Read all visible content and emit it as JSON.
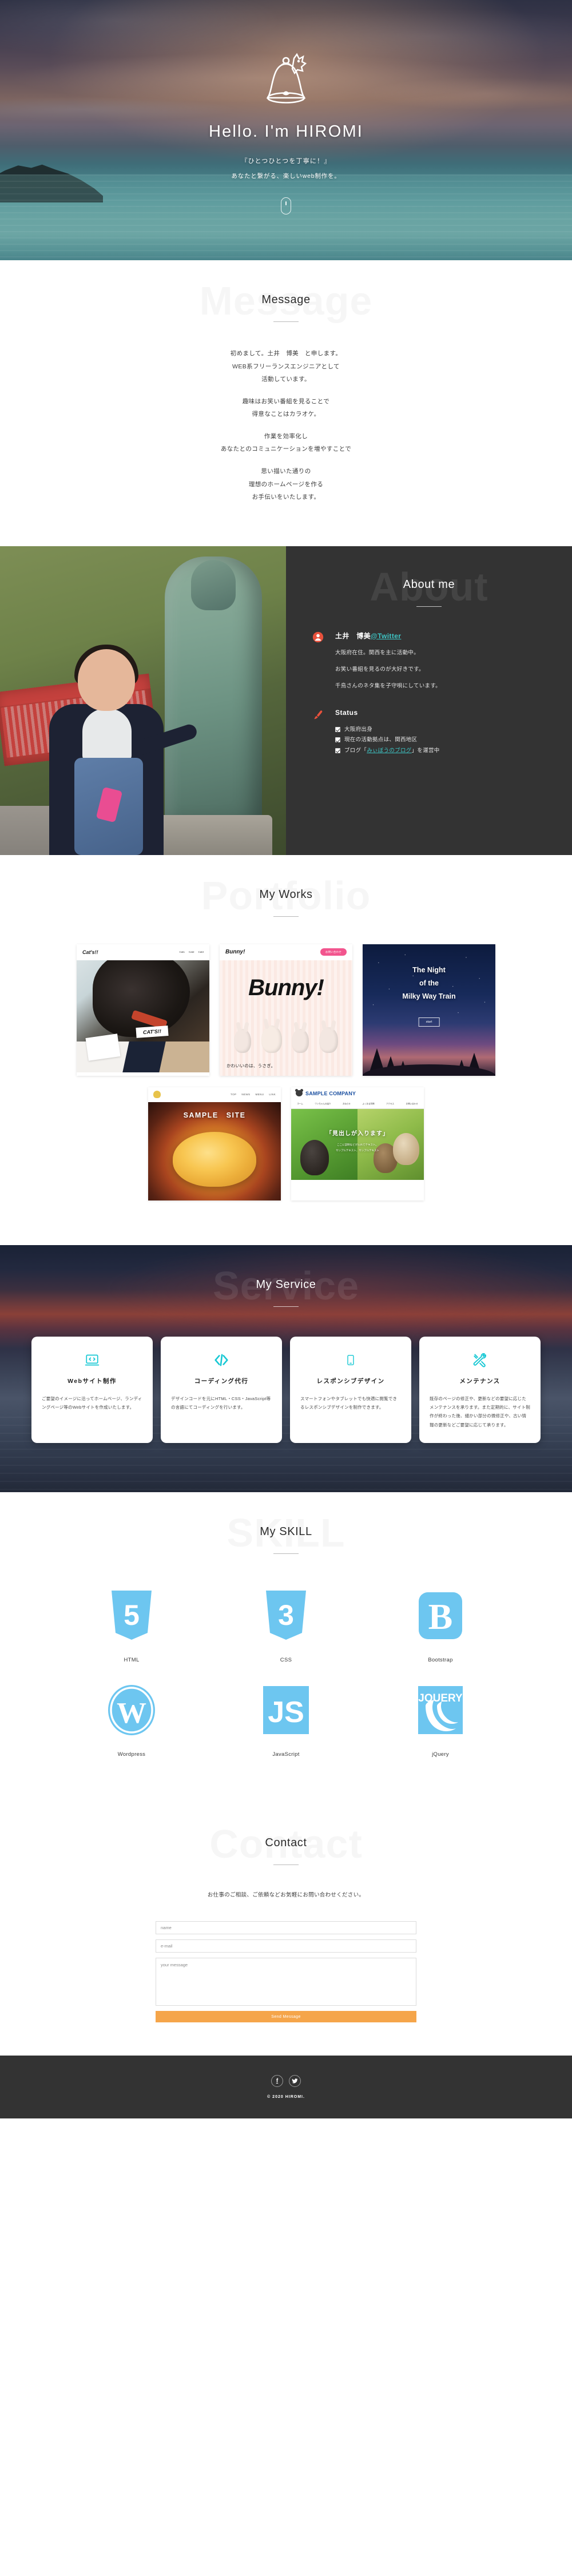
{
  "hero": {
    "logo_icon": "bell-cat-logo",
    "title": "Hello. I'm HIROMI",
    "tagline": "『ひとつひとつを丁寧に！』",
    "subtitle": "あなたと繋がる、楽しいweb制作を。",
    "scroll_icon": "scroll-mouse-icon"
  },
  "message": {
    "ghost": "Message",
    "title": "Message",
    "paragraphs": [
      "初めまして。土井　博美　と申します。\nWEB系フリーランスエンジニアとして\n活動しています。",
      "趣味はお笑い番組を見ることで\n得意なことはカラオケ。",
      "作業を効率化し\nあなたとのコミュニケーションを増やすことで",
      "思い描いた通りの\n理想のホームページを作る\nお手伝いをいたします。"
    ]
  },
  "about": {
    "ghost": "About",
    "title": "About me",
    "photo_alt": "hiromi-with-statue-photo",
    "person_icon": "user-circle-icon",
    "name": "土井　博美",
    "twitter_handle": "@Twitter",
    "bio_line1": "大阪府在住。関西を主に活動中。",
    "bio_line2": "お笑い番組を見るのが大好きです。",
    "bio_line3": "千鳥さんのネタ集を子守唄にしています。",
    "status_icon": "brush-icon",
    "status_title": "Status",
    "status_items": [
      {
        "text_before": "大阪府出身",
        "link": "",
        "text_after": ""
      },
      {
        "text_before": "現在の活動拠点は、関西地区",
        "link": "",
        "text_after": ""
      },
      {
        "text_before": "ブログ「",
        "link": "みぃぼうのブログ",
        "text_after": "」を運営中"
      }
    ]
  },
  "portfolio": {
    "ghost": "Portfolio",
    "title": "My Works",
    "works": [
      {
        "name": "cats-site",
        "logo": "Cat's!!",
        "nav": [
          "Cat1",
          "Cat2",
          "Cat3"
        ],
        "tag": "CAT'S!!"
      },
      {
        "name": "bunny-site",
        "logo": "Bunny!",
        "badge": "お問い合わせ",
        "word": "Bunny!",
        "caption": "かわいいのは、うさぎ。"
      },
      {
        "name": "milky-way-train-site",
        "title_line1": "The Night",
        "title_line2": "of the",
        "title_line3": "Milky Way Train",
        "button": "start"
      },
      {
        "name": "sample-site",
        "nav": [
          "TOP",
          "NEWS",
          "MENU",
          "LINK"
        ],
        "title": "SAMPLE　SITE"
      },
      {
        "name": "sample-company-site",
        "company": "SAMPLE COMPANY",
        "nav": [
          "ホーム",
          "ワンちゃんの紹介",
          "おねらせ",
          "よくある質問",
          "アクセス",
          "お問い合わせ"
        ],
        "headline": "「見出しが入ります」",
        "subtext_line1": "ここに説明などが入れてテキスト。",
        "subtext_line2": "サンプルテキスト、サンプルテキスト"
      }
    ]
  },
  "service": {
    "ghost": "Service",
    "title": "My Service",
    "cards": [
      {
        "icon": "laptop-code-icon",
        "title": "Webサイト制作",
        "desc": "ご要望のイメージに沿ってホームページ、ランディングページ等のWebサイトを作成いたします。"
      },
      {
        "icon": "code-brackets-icon",
        "title": "コーディング代行",
        "desc": "デザインコードを元にHTML・CSS・JavaScript等の言語にてコーディングを行います。"
      },
      {
        "icon": "mobile-phone-icon",
        "title": "レスポンシブデザイン",
        "desc": "スマートフォンやタブレットでも快適に閲覧できるレスポンシブデザインを制作できます。"
      },
      {
        "icon": "tools-icon",
        "title": "メンテナンス",
        "desc": "既存のページの修正や、更新などの要望に応じたメンテナンスを承ります。また定期的に、サイト制作が終わった後、細かい部分の微修正や、古い情報の更新などご要望に応じて承ります。"
      }
    ]
  },
  "skill": {
    "ghost": "SKILL",
    "title": "My SKILL",
    "items": [
      {
        "icon": "html5-icon",
        "label": "HTML",
        "glyph": "5"
      },
      {
        "icon": "css3-icon",
        "label": "CSS",
        "glyph": "3"
      },
      {
        "icon": "bootstrap-icon",
        "label": "Bootstrap",
        "glyph": "B"
      },
      {
        "icon": "wordpress-icon",
        "label": "Wordpress",
        "glyph": "W"
      },
      {
        "icon": "javascript-icon",
        "label": "JavaScript",
        "glyph": "JS"
      },
      {
        "icon": "jquery-icon",
        "label": "jQuery",
        "glyph": "JQUERY"
      }
    ],
    "accent_color": "#6dc6f0"
  },
  "contact": {
    "ghost": "Contact",
    "title": "Contact",
    "lead": "お仕事のご相談、ご依頼などお気軽にお問い合わせください。",
    "name_placeholder": "name",
    "name_value": "",
    "email_placeholder": "e-mail",
    "email_value": "",
    "message_placeholder": "your message",
    "message_value": "",
    "submit_label": "Send Message",
    "submit_color": "#f5a54a"
  },
  "footer": {
    "facebook_icon": "facebook-icon",
    "facebook_glyph": "f",
    "twitter_icon": "twitter-icon",
    "twitter_glyph": "ᴠ",
    "copyright": "© 2020 HIROMI."
  }
}
